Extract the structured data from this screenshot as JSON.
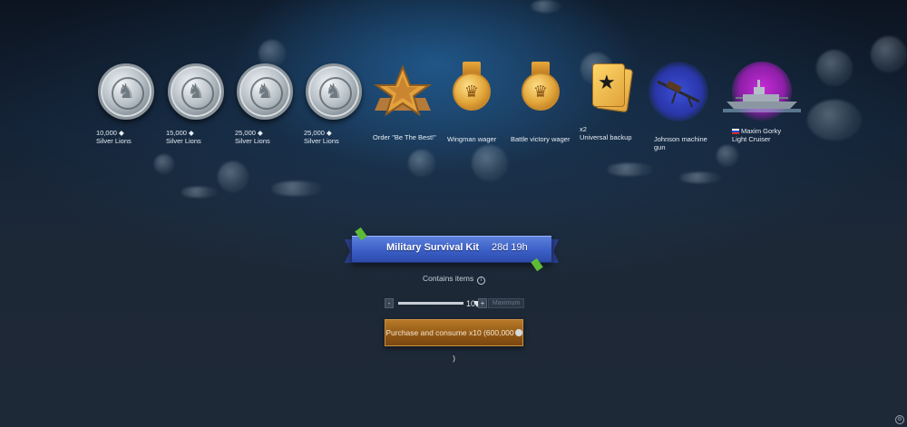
{
  "rewards": [
    {
      "amount": "10,000",
      "label": "Silver Lions",
      "icon": "silver-lions-coin-icon"
    },
    {
      "amount": "15,000",
      "label": "Silver Lions",
      "icon": "silver-lions-coin-icon"
    },
    {
      "amount": "25,000",
      "label": "Silver Lions",
      "icon": "silver-lions-coin-icon"
    },
    {
      "amount": "25,000",
      "label": "Silver Lions",
      "icon": "silver-lions-coin-icon"
    },
    {
      "label": "Order \"Be The Best!\"",
      "icon": "order-star-icon"
    },
    {
      "label": "Wingman wager",
      "icon": "wager-medal-icon"
    },
    {
      "label": "Battle victory wager",
      "icon": "wager-medal-icon"
    },
    {
      "amount": "x2",
      "label": "Universal backup",
      "icon": "backup-card-icon"
    },
    {
      "label": "Johnson machine gun",
      "icon": "machine-gun-icon"
    },
    {
      "flag": "russia-flag-icon",
      "name": "Maxim Gorky",
      "label": "Light Cruiser",
      "icon": "ship-icon"
    }
  ],
  "kit": {
    "title": "Military Survival Kit",
    "timer": "28d 19h",
    "contains_label": "Contains items",
    "info_glyph": "i"
  },
  "quantity": {
    "minus": "-",
    "plus": "+",
    "value": "10",
    "max_label": "Maximum",
    "slider_fraction": 1.0
  },
  "purchase": {
    "label_prefix": "Purchase and consume x10 (600,000",
    "label_suffix": ")"
  },
  "colors": {
    "banner_blue": "#3b5fc7",
    "purchase_orange": "#8f5614",
    "ribbon_green": "#5dbb35"
  }
}
